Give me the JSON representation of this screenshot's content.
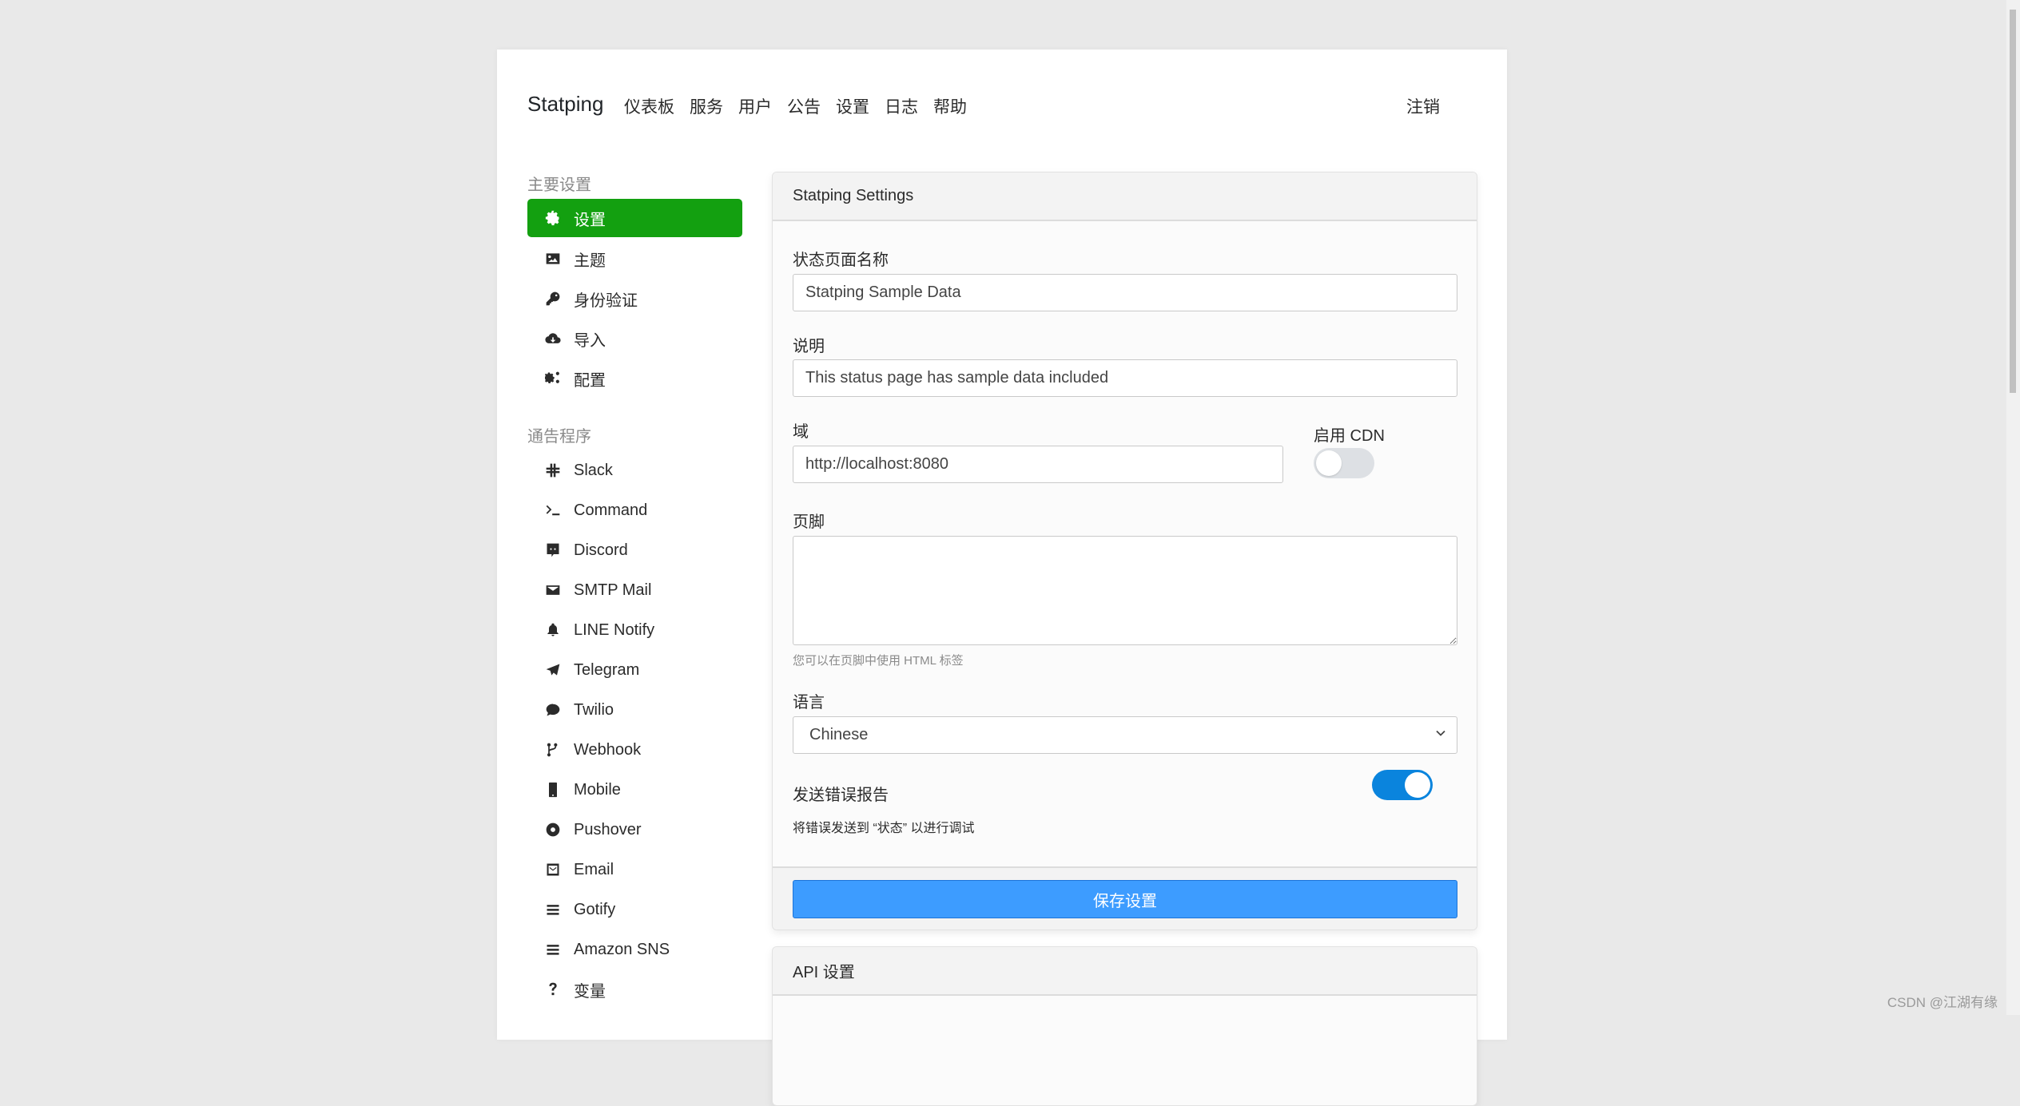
{
  "header": {
    "brand": "Statping",
    "nav": [
      "仪表板",
      "服务",
      "用户",
      "公告",
      "设置",
      "日志",
      "帮助"
    ],
    "logout": "注销"
  },
  "sidebar": {
    "main_heading": "主要设置",
    "main_items": [
      {
        "label": "设置",
        "icon": "gear-icon",
        "active": true
      },
      {
        "label": "主题",
        "icon": "image-icon",
        "active": false
      },
      {
        "label": "身份验证",
        "icon": "key-icon",
        "active": false
      },
      {
        "label": "导入",
        "icon": "cloud-download-icon",
        "active": false
      },
      {
        "label": "配置",
        "icon": "cogs-icon",
        "active": false
      }
    ],
    "notifier_heading": "通告程序",
    "notifier_items": [
      {
        "label": "Slack",
        "icon": "slack-icon"
      },
      {
        "label": "Command",
        "icon": "terminal-icon"
      },
      {
        "label": "Discord",
        "icon": "discord-icon"
      },
      {
        "label": "SMTP Mail",
        "icon": "envelope-icon"
      },
      {
        "label": "LINE Notify",
        "icon": "bell-icon"
      },
      {
        "label": "Telegram",
        "icon": "telegram-icon"
      },
      {
        "label": "Twilio",
        "icon": "comment-icon"
      },
      {
        "label": "Webhook",
        "icon": "code-branch-icon"
      },
      {
        "label": "Mobile",
        "icon": "mobile-icon"
      },
      {
        "label": "Pushover",
        "icon": "dot-circle-icon"
      },
      {
        "label": "Email",
        "icon": "envelope-square-icon"
      },
      {
        "label": "Gotify",
        "icon": "bars-icon"
      },
      {
        "label": "Amazon SNS",
        "icon": "bars-icon"
      },
      {
        "label": "变量",
        "icon": "question-icon"
      }
    ]
  },
  "settings_card": {
    "title": "Statping Settings",
    "name_label": "状态页面名称",
    "name_value": "Statping Sample Data",
    "description_label": "说明",
    "description_value": "This status page has sample data included",
    "domain_label": "域",
    "domain_value": "http://localhost:8080",
    "cdn_label": "启用 CDN",
    "cdn_enabled": false,
    "footer_label": "页脚",
    "footer_value": "",
    "footer_help": "您可以在页脚中使用 HTML 标签",
    "language_label": "语言",
    "language_value": "Chinese",
    "error_report_label": "发送错误报告",
    "error_report_enabled": true,
    "error_report_help": "将错误发送到 “状态” 以进行调试",
    "save_label": "保存设置"
  },
  "api_card": {
    "title": "API 设置"
  },
  "colors": {
    "active_green": "#13a010",
    "save_blue": "#3d9cff",
    "toggle_on": "#0a84dd"
  },
  "watermark": "CSDN @江湖有缘"
}
